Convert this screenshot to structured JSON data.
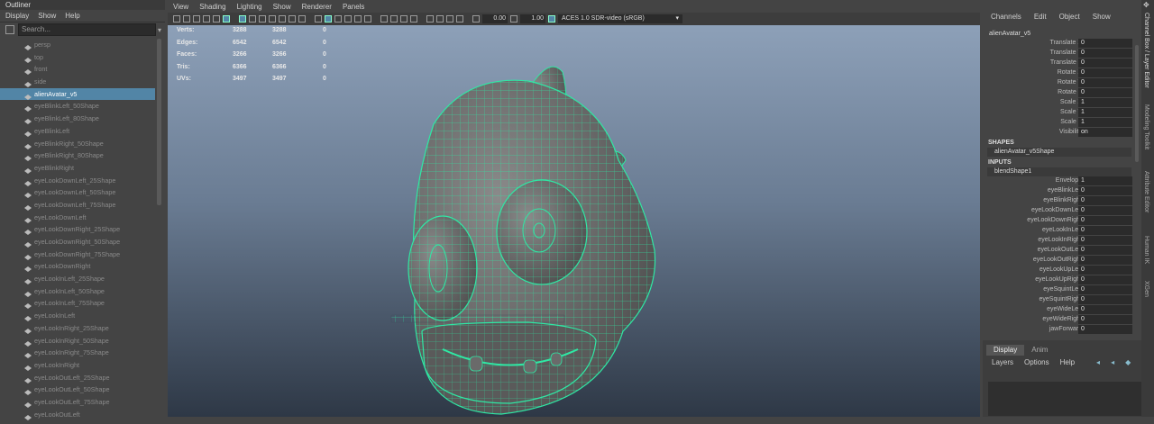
{
  "outliner": {
    "title": "Outliner",
    "menu": [
      "Display",
      "Show",
      "Help"
    ],
    "search_placeholder": "Search...",
    "items": [
      {
        "label": "persp",
        "selected": false
      },
      {
        "label": "top",
        "selected": false
      },
      {
        "label": "front",
        "selected": false
      },
      {
        "label": "side",
        "selected": false
      },
      {
        "label": "alienAvatar_v5",
        "selected": true
      },
      {
        "label": "eyeBlinkLeft_50Shape",
        "selected": false
      },
      {
        "label": "eyeBlinkLeft_80Shape",
        "selected": false
      },
      {
        "label": "eyeBlinkLeft",
        "selected": false
      },
      {
        "label": "eyeBlinkRight_50Shape",
        "selected": false
      },
      {
        "label": "eyeBlinkRight_80Shape",
        "selected": false
      },
      {
        "label": "eyeBlinkRight",
        "selected": false
      },
      {
        "label": "eyeLookDownLeft_25Shape",
        "selected": false
      },
      {
        "label": "eyeLookDownLeft_50Shape",
        "selected": false
      },
      {
        "label": "eyeLookDownLeft_75Shape",
        "selected": false
      },
      {
        "label": "eyeLookDownLeft",
        "selected": false
      },
      {
        "label": "eyeLookDownRight_25Shape",
        "selected": false
      },
      {
        "label": "eyeLookDownRight_50Shape",
        "selected": false
      },
      {
        "label": "eyeLookDownRight_75Shape",
        "selected": false
      },
      {
        "label": "eyeLookDownRight",
        "selected": false
      },
      {
        "label": "eyeLookInLeft_25Shape",
        "selected": false
      },
      {
        "label": "eyeLookInLeft_50Shape",
        "selected": false
      },
      {
        "label": "eyeLookInLeft_75Shape",
        "selected": false
      },
      {
        "label": "eyeLookInLeft",
        "selected": false
      },
      {
        "label": "eyeLookInRight_25Shape",
        "selected": false
      },
      {
        "label": "eyeLookInRight_50Shape",
        "selected": false
      },
      {
        "label": "eyeLookInRight_75Shape",
        "selected": false
      },
      {
        "label": "eyeLookInRight",
        "selected": false
      },
      {
        "label": "eyeLookOutLeft_25Shape",
        "selected": false
      },
      {
        "label": "eyeLookOutLeft_50Shape",
        "selected": false
      },
      {
        "label": "eyeLookOutLeft_75Shape",
        "selected": false
      },
      {
        "label": "eyeLookOutLeft",
        "selected": false
      }
    ]
  },
  "viewport": {
    "menu": [
      "View",
      "Shading",
      "Lighting",
      "Show",
      "Renderer",
      "Panels"
    ],
    "exposure": "0.00",
    "gamma": "1.00",
    "color_space": "ACES 1.0 SDR-video (sRGB)",
    "hud": [
      {
        "label": "Verts:",
        "a": "3288",
        "b": "3288",
        "c": "0"
      },
      {
        "label": "Edges:",
        "a": "6542",
        "b": "6542",
        "c": "0"
      },
      {
        "label": "Faces:",
        "a": "3266",
        "b": "3266",
        "c": "0"
      },
      {
        "label": "Tris:",
        "a": "6366",
        "b": "6366",
        "c": "0"
      },
      {
        "label": "UVs:",
        "a": "3497",
        "b": "3497",
        "c": "0"
      }
    ],
    "wire_color": "#2fe8a4"
  },
  "channel_box": {
    "menu": [
      "Channels",
      "Edit",
      "Object",
      "Show"
    ],
    "object_name": "alienAvatar_v5",
    "transform": [
      {
        "k": "Translate X",
        "v": "0"
      },
      {
        "k": "Translate Y",
        "v": "0"
      },
      {
        "k": "Translate Z",
        "v": "0"
      },
      {
        "k": "Rotate X",
        "v": "0"
      },
      {
        "k": "Rotate Y",
        "v": "0"
      },
      {
        "k": "Rotate Z",
        "v": "0"
      },
      {
        "k": "Scale X",
        "v": "1"
      },
      {
        "k": "Scale Y",
        "v": "1"
      },
      {
        "k": "Scale Z",
        "v": "1"
      },
      {
        "k": "Visibility",
        "v": "on"
      }
    ],
    "shapes_header": "SHAPES",
    "shape_name": "alienAvatar_v5Shape",
    "inputs_header": "INPUTS",
    "input_name": "blendShape1",
    "inputs": [
      {
        "k": "Envelope",
        "v": "1"
      },
      {
        "k": "eyeBlinkLeft",
        "v": "0"
      },
      {
        "k": "eyeBlinkRight",
        "v": "0"
      },
      {
        "k": "eyeLookDownLeft",
        "v": "0"
      },
      {
        "k": "eyeLookDownRight",
        "v": "0"
      },
      {
        "k": "eyeLookInLeft",
        "v": "0"
      },
      {
        "k": "eyeLookInRight",
        "v": "0"
      },
      {
        "k": "eyeLookOutLeft",
        "v": "0"
      },
      {
        "k": "eyeLookOutRight",
        "v": "0"
      },
      {
        "k": "eyeLookUpLeft",
        "v": "0"
      },
      {
        "k": "eyeLookUpRight",
        "v": "0"
      },
      {
        "k": "eyeSquintLeft",
        "v": "0"
      },
      {
        "k": "eyeSquintRight",
        "v": "0"
      },
      {
        "k": "eyeWideLeft",
        "v": "0"
      },
      {
        "k": "eyeWideRight",
        "v": "0"
      },
      {
        "k": "jawForward",
        "v": "0"
      }
    ]
  },
  "layer_editor": {
    "tabs": [
      "Display",
      "Anim"
    ],
    "menu": [
      "Layers",
      "Options",
      "Help"
    ]
  },
  "side_tabs": [
    "Channel Box / Layer Editor",
    "Modeling Toolkit",
    "Attribute Editor",
    "Human IK",
    "XGen"
  ]
}
